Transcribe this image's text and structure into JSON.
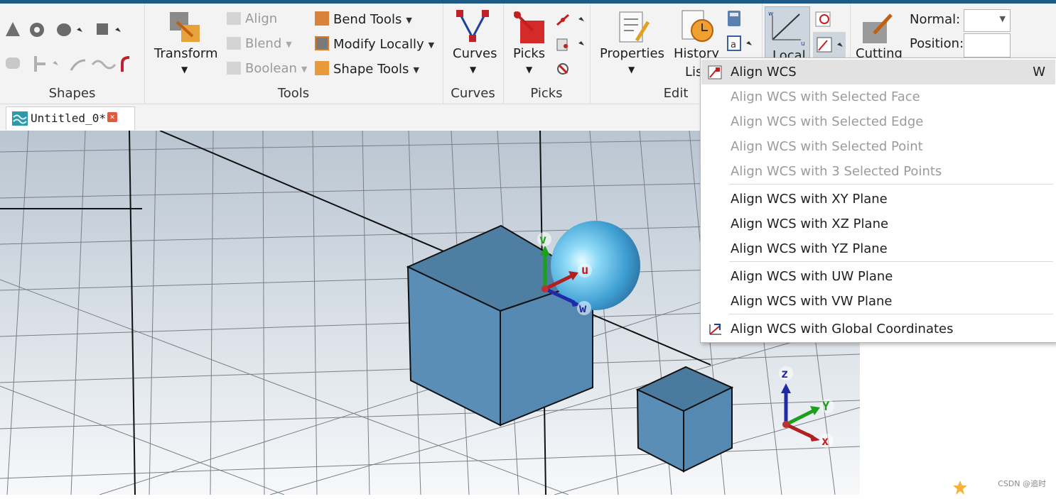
{
  "ribbon": {
    "shapes_label": "Shapes",
    "transform_label": "Transform",
    "align_label": "Align",
    "blend_label": "Blend",
    "boolean_label": "Boolean",
    "bend_tools_label": "Bend Tools",
    "modify_locally_label": "Modify Locally",
    "shape_tools_label": "Shape Tools",
    "tools_group_label": "Tools",
    "curves_label": "Curves",
    "curves_group_label": "Curves",
    "picks_label": "Picks",
    "picks_group_label": "Picks",
    "properties_label": "Properties",
    "history_label": "History",
    "history_sub": "Lis",
    "edit_group_label": "Edit",
    "local_label": "Local",
    "cutting_label": "Cutting",
    "normal_label": "Normal:",
    "position_label": "Position:"
  },
  "tab": {
    "title": "Untitled_0*"
  },
  "menu": {
    "items": [
      {
        "label": "Align WCS",
        "shortcut": "W",
        "enabled": true
      },
      {
        "label": "Align WCS with Selected Face",
        "enabled": false
      },
      {
        "label": "Align WCS with Selected Edge",
        "enabled": false
      },
      {
        "label": "Align WCS with Selected Point",
        "enabled": false
      },
      {
        "label": "Align WCS with 3 Selected Points",
        "enabled": false
      },
      {
        "label": "Align WCS with XY Plane",
        "enabled": true
      },
      {
        "label": "Align WCS with XZ Plane",
        "enabled": true
      },
      {
        "label": "Align WCS with YZ Plane",
        "enabled": true
      },
      {
        "label": "Align WCS with UW Plane",
        "enabled": true
      },
      {
        "label": "Align WCS with VW Plane",
        "enabled": true
      },
      {
        "label": "Align WCS with Global Coordinates",
        "enabled": true
      }
    ]
  },
  "viewport": {
    "wcs_axes": {
      "u": "u",
      "v": "v",
      "w": "w"
    },
    "global_axes": {
      "x": "x",
      "y": "Y",
      "z": "z"
    }
  },
  "watermark": "CSDN @追时",
  "colors": {
    "accent": "#1f5a86",
    "shape_fill": "#5b8db5",
    "menu_highlight": "#e2e2e2"
  }
}
